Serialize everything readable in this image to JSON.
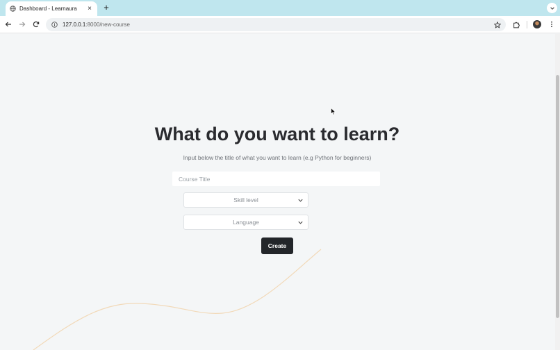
{
  "browser": {
    "tab": {
      "title": "Dashboard - Learnaura",
      "favicon": "globe-icon"
    },
    "url": {
      "host": "127.0.0.1",
      "rest": ":8000/new-course"
    }
  },
  "main": {
    "heading": "What do you want to learn?",
    "subtext": "Input below the title of what you want to learn (e.g Python for beginners)",
    "course_title_placeholder": "Course Title",
    "course_title_value": "",
    "skill_level": {
      "selected": "Skill level"
    },
    "language": {
      "selected": "Language"
    },
    "create_label": "Create"
  },
  "colors": {
    "tabbar": "#bfe6ee",
    "page_bg": "#f4f6f7",
    "button_bg": "#23262a",
    "wave": "#f2d9b8"
  }
}
